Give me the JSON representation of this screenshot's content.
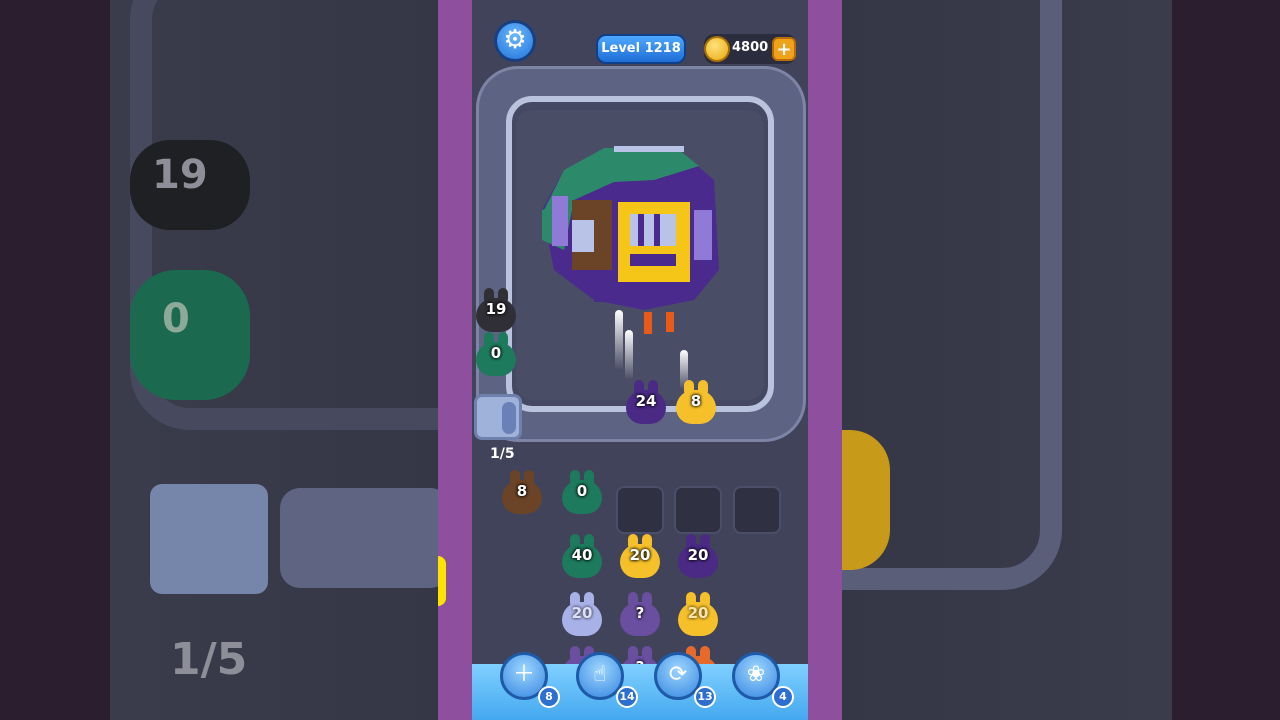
{
  "hud": {
    "settings_icon": "gear-icon",
    "level_label": "Level 1218",
    "coins": "4800",
    "add_coins_label": "+"
  },
  "shooter_queue": [
    {
      "count": "19",
      "color": "#2f2f35"
    },
    {
      "count": "0",
      "color": "#1d7a5c"
    }
  ],
  "progress": "1/5",
  "conveyor_bunnies": [
    {
      "count": "24",
      "color": "#4b2a86"
    },
    {
      "count": "8",
      "color": "#f5c02a"
    }
  ],
  "slots": [
    {
      "count": "8",
      "color": "#6b4326"
    },
    {
      "count": "0",
      "color": "#1d7a5c"
    },
    {
      "count": "",
      "color": ""
    },
    {
      "count": "",
      "color": ""
    },
    {
      "count": "",
      "color": ""
    }
  ],
  "grid_row_1": [
    {
      "count": "40",
      "color": "#1d7a5c"
    },
    {
      "count": "20",
      "color": "#f5c02a"
    },
    {
      "count": "20",
      "color": "#4b2a86"
    }
  ],
  "grid_row_2": [
    {
      "count": "20",
      "color": "#a9b2e8"
    },
    {
      "count": "?",
      "color": "#6a4fa0"
    },
    {
      "count": "20",
      "color": "#f5c02a"
    }
  ],
  "grid_row_3": [
    {
      "count": "",
      "color": "#6a4fa0"
    },
    {
      "count": "?",
      "color": "#6a4fa0"
    },
    {
      "count": "",
      "color": "#e86a2a"
    }
  ],
  "boosters": [
    {
      "icon": "add-slot-icon",
      "count": "8"
    },
    {
      "icon": "hand-icon",
      "count": "14"
    },
    {
      "icon": "shuffle-icon",
      "count": "13"
    },
    {
      "icon": "bunny-icon",
      "count": "4"
    }
  ],
  "backdrop": {
    "left_count_top": "19",
    "left_count_bottom": "0",
    "left_progress": "1/5"
  }
}
